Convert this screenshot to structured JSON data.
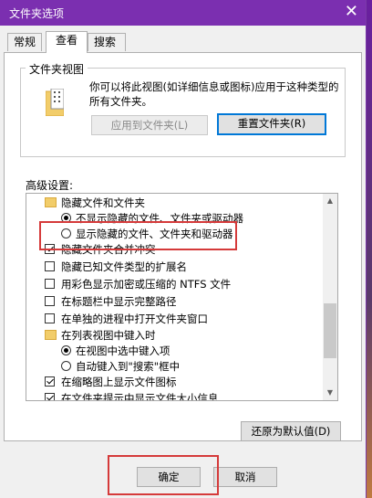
{
  "window": {
    "title": "文件夹选项",
    "close_glyph": "✕"
  },
  "tabs": [
    {
      "label": "常规"
    },
    {
      "label": "查看"
    },
    {
      "label": "搜索"
    }
  ],
  "folder_views": {
    "group_label": "文件夹视图",
    "description": "你可以将此视图(如详细信息或图标)应用于这种类型的所有文件夹。",
    "apply_button": "应用到文件夹(L)",
    "reset_button": "重置文件夹(R)"
  },
  "advanced": {
    "label": "高级设置:",
    "items": [
      {
        "type": "folder",
        "label": "隐藏文件和文件夹"
      },
      {
        "type": "radio",
        "checked": true,
        "label": "不显示隐藏的文件、文件夹或驱动器"
      },
      {
        "type": "radio",
        "checked": false,
        "label": "显示隐藏的文件、文件夹和驱动器"
      },
      {
        "type": "checkbox",
        "checked": true,
        "label": "隐藏文件夹合并冲突"
      },
      {
        "type": "checkbox",
        "checked": false,
        "label": "隐藏已知文件类型的扩展名"
      },
      {
        "type": "checkbox",
        "checked": false,
        "label": "用彩色显示加密或压缩的 NTFS 文件"
      },
      {
        "type": "checkbox",
        "checked": false,
        "label": "在标题栏中显示完整路径"
      },
      {
        "type": "checkbox",
        "checked": false,
        "label": "在单独的进程中打开文件夹窗口"
      },
      {
        "type": "folder",
        "label": "在列表视图中键入时"
      },
      {
        "type": "radio",
        "checked": true,
        "label": "在视图中选中键入项"
      },
      {
        "type": "radio",
        "checked": false,
        "label": "自动键入到\"搜索\"框中"
      },
      {
        "type": "checkbox",
        "checked": true,
        "label": "在缩略图上显示文件图标"
      },
      {
        "type": "checkbox",
        "checked": true,
        "label": "在文件夹提示中显示文件大小信息"
      }
    ],
    "restore_button": "还原为默认值(D)"
  },
  "footer": {
    "ok_button": "确定",
    "cancel_button": "取消"
  },
  "colors": {
    "titlebar": "#7b2fb0",
    "highlight": "#d53a3a",
    "focus": "#0078d7"
  }
}
